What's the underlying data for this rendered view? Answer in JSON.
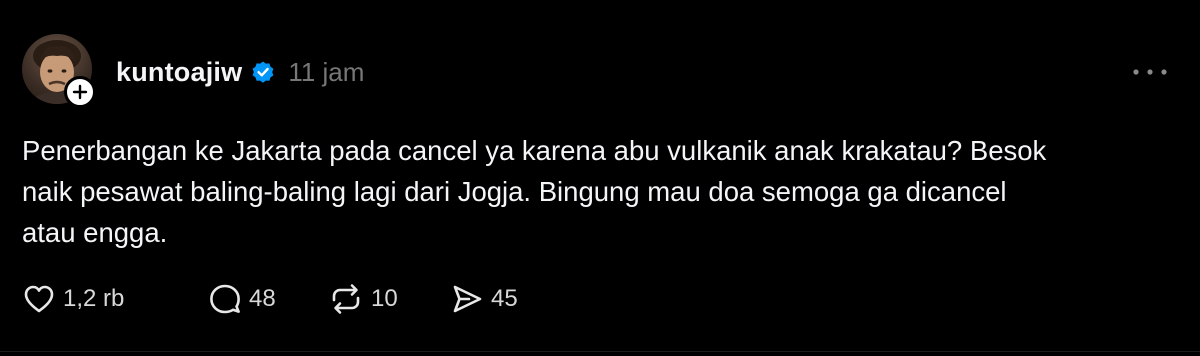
{
  "post": {
    "author": {
      "username": "kuntoajiw",
      "verified": true,
      "avatar_icon": "profile-photo",
      "follow_icon": "plus-icon"
    },
    "timestamp": "11 jam",
    "more_icon": "more-icon",
    "text": "Penerbangan ke Jakarta pada cancel ya karena abu vulkanik anak krakatau? Besok\nnaik pesawat baling-baling lagi dari Jogja. Bingung mau doa semoga ga dicancel\natau engga.",
    "actions": {
      "like": {
        "icon": "heart-icon",
        "count": "1,2 rb"
      },
      "reply": {
        "icon": "comment-icon",
        "count": "48"
      },
      "repost": {
        "icon": "repost-icon",
        "count": "10"
      },
      "share": {
        "icon": "send-icon",
        "count": "45"
      }
    }
  },
  "colors": {
    "background": "#000000",
    "text": "#f3f5f7",
    "muted": "#777777",
    "verified_badge": "#0095f6"
  }
}
